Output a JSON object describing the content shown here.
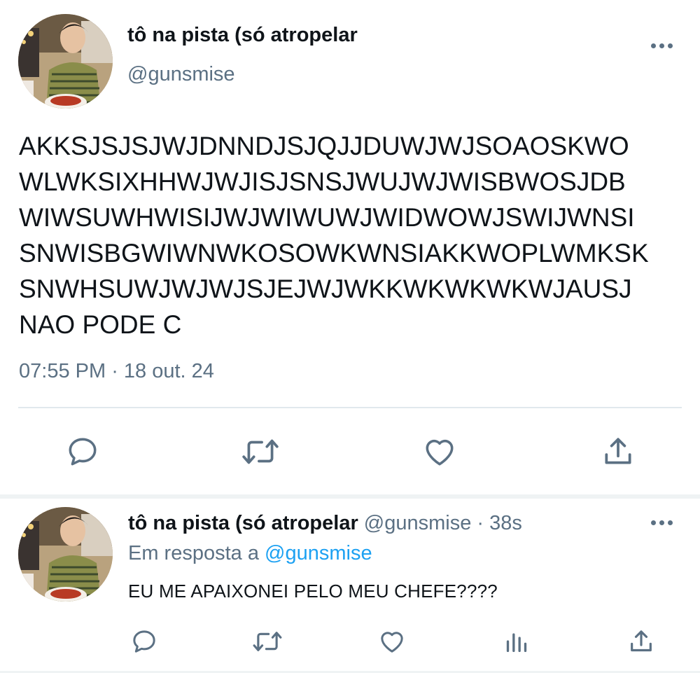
{
  "main_tweet": {
    "display_name": "tô na pista (só atropelar",
    "handle": "@gunsmise",
    "text_lines": [
      "AKKSJSJSJWJDNNDJSJQJJDUWJWJSOAOSKWO",
      "WLWKSIXHHWJWJISJSNSJWUJWJWISBWOSJDB",
      "WIWSUWHWISIJWJWIWUWJWIDWOWJSWIJWNSI",
      "SNWISBGWIWNWKOSOWKWNSIAKKWOPLWMKSK",
      "SNWHSUWJWJWJSJEJWJWKKWKWKWKWJAUSJ",
      "NAO PODE C"
    ],
    "time": "07:55 PM",
    "separator": " · ",
    "date": "18 out. 24",
    "actions": [
      "reply-icon",
      "retweet-icon",
      "like-icon",
      "share-icon"
    ]
  },
  "reply_tweet": {
    "display_name": "tô na pista (só atropelar",
    "handle": "@gunsmise",
    "dot": " · ",
    "time_ago": "38s",
    "reply_prefix": "Em resposta a ",
    "reply_mention": "@gunsmise",
    "text": "EU ME APAIXONEI PELO MEU CHEFE????",
    "actions": [
      "reply-icon",
      "retweet-icon",
      "like-icon",
      "analytics-icon",
      "share-icon"
    ]
  },
  "colors": {
    "text": "#0f1419",
    "secondary": "#5b7083",
    "accent": "#1da1f2",
    "divider": "#e1e8ed"
  }
}
